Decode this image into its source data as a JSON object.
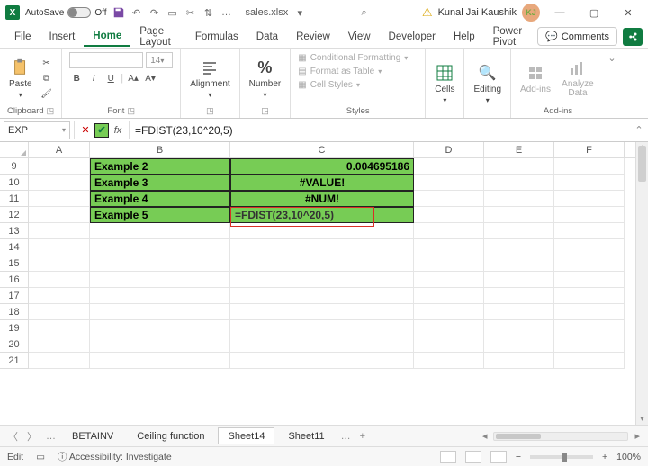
{
  "titlebar": {
    "autosave_label": "AutoSave",
    "autosave_state": "Off",
    "filename": "sales.xlsx",
    "search_glyph": "⌕",
    "username": "Kunal Jai Kaushik",
    "avatar_initials": "KJ"
  },
  "menu": {
    "tabs": [
      "File",
      "Insert",
      "Home",
      "Page Layout",
      "Formulas",
      "Data",
      "Review",
      "View",
      "Developer",
      "Help",
      "Power Pivot"
    ],
    "active_index": 2,
    "comments_label": "Comments"
  },
  "ribbon": {
    "clipboard": {
      "paste": "Paste",
      "label": "Clipboard"
    },
    "font": {
      "size": "14",
      "label": "Font",
      "b": "B",
      "i": "I",
      "u": "U"
    },
    "alignment": {
      "btn": "Alignment"
    },
    "number": {
      "btn": "Number",
      "percent": "%"
    },
    "styles": {
      "cond": "Conditional Formatting",
      "table": "Format as Table",
      "cell": "Cell Styles",
      "label": "Styles"
    },
    "cells": {
      "btn": "Cells"
    },
    "editing": {
      "btn": "Editing"
    },
    "addins": {
      "btn": "Add-ins",
      "analyze": "Analyze Data",
      "label": "Add-ins"
    }
  },
  "fbar": {
    "namebox": "EXP",
    "fx": "fx",
    "formula": "=FDIST(23,10^20,5)"
  },
  "grid": {
    "cols": [
      "A",
      "B",
      "C",
      "D",
      "E",
      "F"
    ],
    "rownums": [
      9,
      10,
      11,
      12,
      13,
      14,
      15,
      16,
      17,
      18,
      19,
      20,
      21
    ],
    "cells": {
      "B9": "Example 2",
      "C9": "0.004695186",
      "B10": "Example 3",
      "C10": "#VALUE!",
      "B11": "Example 4",
      "C11": "#NUM!",
      "B12": "Example 5",
      "C12": "=FDIST(23,10^20,5)"
    }
  },
  "sheets": {
    "tabs": [
      "BETAINV",
      "Ceiling function",
      "Sheet14",
      "Sheet11"
    ],
    "active_index": 2,
    "ellipsis": "…",
    "plus": "+"
  },
  "status": {
    "mode": "Edit",
    "accessibility": "Accessibility: Investigate",
    "zoom": "100%"
  }
}
